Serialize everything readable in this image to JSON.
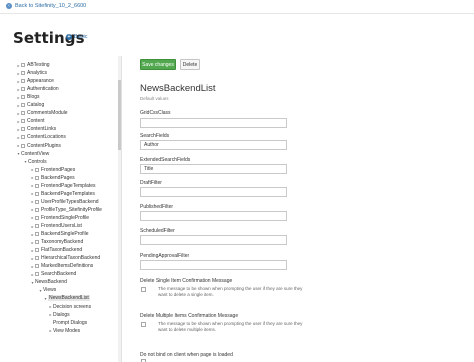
{
  "topbar": {
    "back_label": "Back to Sitefinity_10_2_6600",
    "back_icon": "chevron-left-icon"
  },
  "header": {
    "title": "Settings",
    "basic_label": "Basic",
    "basic_icon": "plus-circle-icon"
  },
  "sidebar": {
    "items": [
      {
        "label": "ABTesting",
        "level": 0,
        "expanded": false
      },
      {
        "label": "Analytics",
        "level": 0,
        "expanded": false
      },
      {
        "label": "Appearance",
        "level": 0,
        "expanded": false
      },
      {
        "label": "Authentication",
        "level": 0,
        "expanded": false
      },
      {
        "label": "Blogs",
        "level": 0,
        "expanded": false
      },
      {
        "label": "Catalog",
        "level": 0,
        "expanded": false
      },
      {
        "label": "CommentsModule",
        "level": 0,
        "expanded": false
      },
      {
        "label": "Content",
        "level": 0,
        "expanded": false
      },
      {
        "label": "ContentLinks",
        "level": 0,
        "expanded": false
      },
      {
        "label": "ContentLocations",
        "level": 0,
        "expanded": false
      },
      {
        "label": "ContentPlugins",
        "level": 0,
        "expanded": false
      },
      {
        "label": "ContentView",
        "level": 0,
        "expanded": true
      },
      {
        "label": "Controls",
        "level": 1,
        "expanded": true
      },
      {
        "label": "FrontendPages",
        "level": 2,
        "expanded": false
      },
      {
        "label": "BackendPages",
        "level": 2,
        "expanded": false
      },
      {
        "label": "FrontendPageTemplates",
        "level": 2,
        "expanded": false
      },
      {
        "label": "BackendPageTemplates",
        "level": 2,
        "expanded": false
      },
      {
        "label": "UserProfileTypesBackend",
        "level": 2,
        "expanded": false
      },
      {
        "label": "ProfileType_SitefinityProfile",
        "level": 2,
        "expanded": false
      },
      {
        "label": "FrontendSingleProfile",
        "level": 2,
        "expanded": false
      },
      {
        "label": "FrontendUsersList",
        "level": 2,
        "expanded": false
      },
      {
        "label": "BackendSingleProfile",
        "level": 2,
        "expanded": false
      },
      {
        "label": "TaxonomyBackend",
        "level": 2,
        "expanded": false
      },
      {
        "label": "FlatTaxonBackend",
        "level": 2,
        "expanded": false
      },
      {
        "label": "HierarchicalTaxonBackend",
        "level": 2,
        "expanded": false
      },
      {
        "label": "MarkedItemsDefinitions",
        "level": 2,
        "expanded": false
      },
      {
        "label": "SearchBackend",
        "level": 2,
        "expanded": false
      },
      {
        "label": "NewsBackend",
        "level": 2,
        "expanded": true
      },
      {
        "label": "Views",
        "level": 3,
        "expanded": true
      },
      {
        "label": "NewsBackendList",
        "level": 4,
        "expanded": true,
        "selected": true
      },
      {
        "label": "Decision screens",
        "level": 5,
        "expanded": false
      },
      {
        "label": "Dialogs",
        "level": 5,
        "expanded": false
      },
      {
        "label": "Prompt Dialogs",
        "level": 5,
        "expanded": false,
        "leaf": true
      },
      {
        "label": "View Modes",
        "level": 5,
        "expanded": false
      }
    ]
  },
  "toolbar": {
    "save_label": "Save changes",
    "delete_label": "Delete"
  },
  "main": {
    "title": "NewsBackendList",
    "subtitle": "Default values",
    "fields": {
      "gridcss_label": "GridCssClass",
      "gridcss_value": "",
      "searchfields_label": "SearchFields",
      "searchfields_value": "Author",
      "extsearch_label": "ExtendedSearchFields",
      "extsearch_value": "Title",
      "draft_label": "DraftFilter",
      "draft_value": "",
      "published_label": "PublishedFilter",
      "published_value": "",
      "scheduled_label": "ScheduledFilter",
      "scheduled_value": "",
      "pending_label": "PendingApprovalFilter",
      "pending_value": "",
      "delete_single_label": "Delete Single Item Confirmation Message",
      "delete_single_desc": "The message to be shown when prompting the user if they are sure they want to delete a single item.",
      "delete_multi_label": "Delete Multiple Items Confirmation Message",
      "delete_multi_desc": "The message to be shown when prompting the user if they are sure they want to delete multiple items.",
      "donotbind_label": "Do not bind on client when page is loaded"
    }
  },
  "colors": {
    "accent": "#52a84f",
    "link": "#2b6ca3"
  }
}
